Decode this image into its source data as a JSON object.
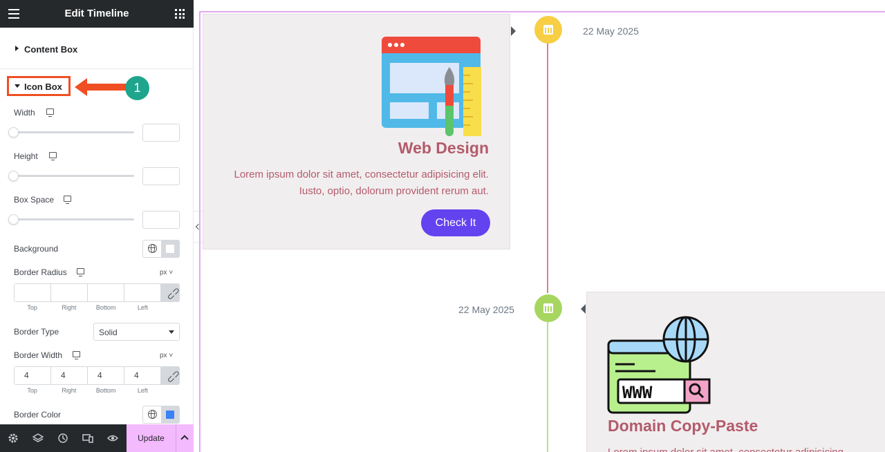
{
  "panel": {
    "title": "Edit Timeline",
    "sections": {
      "content_box": "Content Box",
      "icon_box": "Icon Box"
    },
    "step_badge": "1",
    "controls": {
      "width_label": "Width",
      "height_label": "Height",
      "box_space_label": "Box Space",
      "background_label": "Background",
      "border_radius_label": "Border Radius",
      "border_radius_unit": "px ˅",
      "border_type_label": "Border Type",
      "border_type_value": "Solid",
      "border_width_label": "Border Width",
      "border_width_unit": "px ˅",
      "border_width_values": [
        "4",
        "4",
        "4",
        "4"
      ],
      "dim_labels": [
        "Top",
        "Right",
        "Bottom",
        "Left"
      ],
      "border_color_label": "Border Color",
      "border_color": "#3b82f6"
    },
    "footer": {
      "update_label": "Update"
    }
  },
  "timeline": {
    "item1": {
      "date": "22 May 2025",
      "title": "Web Design",
      "description": "Lorem ipsum dolor sit amet, consectetur adipisicing elit. Iusto, optio, dolorum provident rerum aut.",
      "button": "Check It",
      "dot_color": "#f7ce44"
    },
    "item2": {
      "date": "22 May 2025",
      "title": "Domain Copy-Paste",
      "description": "Lorem ipsum dolor sit amet, consectetur adipisicing",
      "www_text": "WWW",
      "dot_color": "#a7d660"
    }
  },
  "icons": [
    "menu-icon",
    "apps-grid-icon",
    "monitor-icon",
    "globe-icon",
    "link-icon",
    "settings-icon",
    "layers-icon",
    "history-icon",
    "responsive-icon",
    "eye-icon",
    "chevron-up-icon",
    "calendar-icon",
    "chevron-left-icon"
  ]
}
